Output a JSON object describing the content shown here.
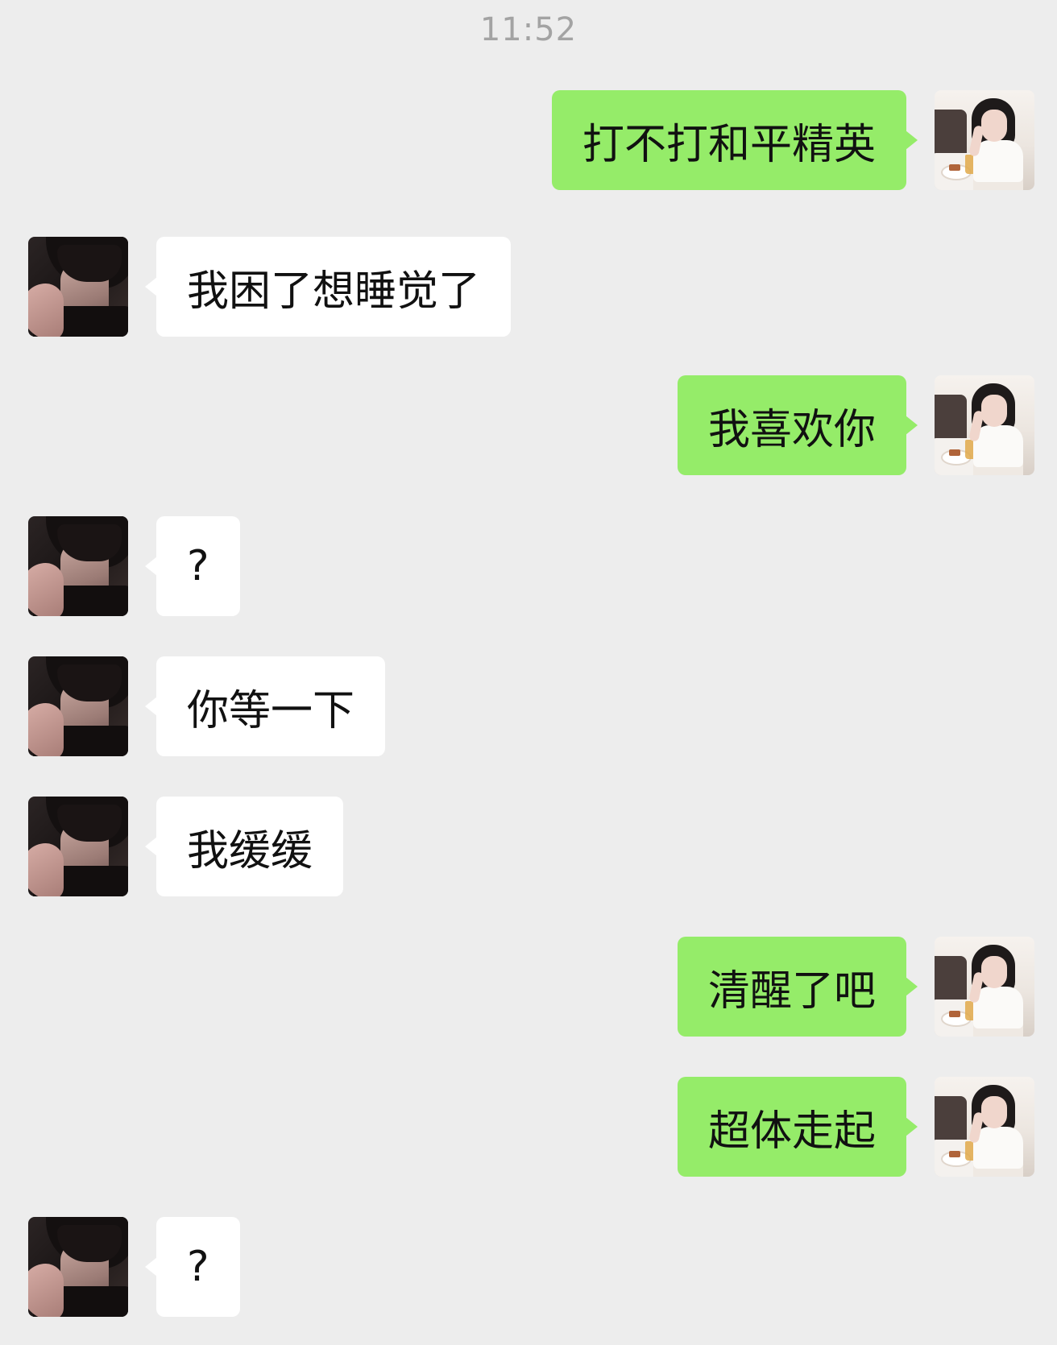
{
  "chat": {
    "timestamp": "11:52",
    "messages": [
      {
        "side": "right",
        "text": "打不打和平精英"
      },
      {
        "side": "left",
        "text": "我困了想睡觉了"
      },
      {
        "side": "right",
        "text": "我喜欢你"
      },
      {
        "side": "left",
        "text": "?"
      },
      {
        "side": "left",
        "text": "你等一下"
      },
      {
        "side": "left",
        "text": "我缓缓"
      },
      {
        "side": "right",
        "text": "清醒了吧"
      },
      {
        "side": "right",
        "text": "超体走起"
      },
      {
        "side": "left",
        "text": "?"
      }
    ]
  },
  "colors": {
    "background": "#ededed",
    "sent_bubble": "#95ec69",
    "received_bubble": "#ffffff",
    "timestamp_text": "#a3a3a3"
  },
  "icons": {
    "left_avatar": "avatar-contact-illustration",
    "right_avatar": "avatar-self-photo"
  }
}
